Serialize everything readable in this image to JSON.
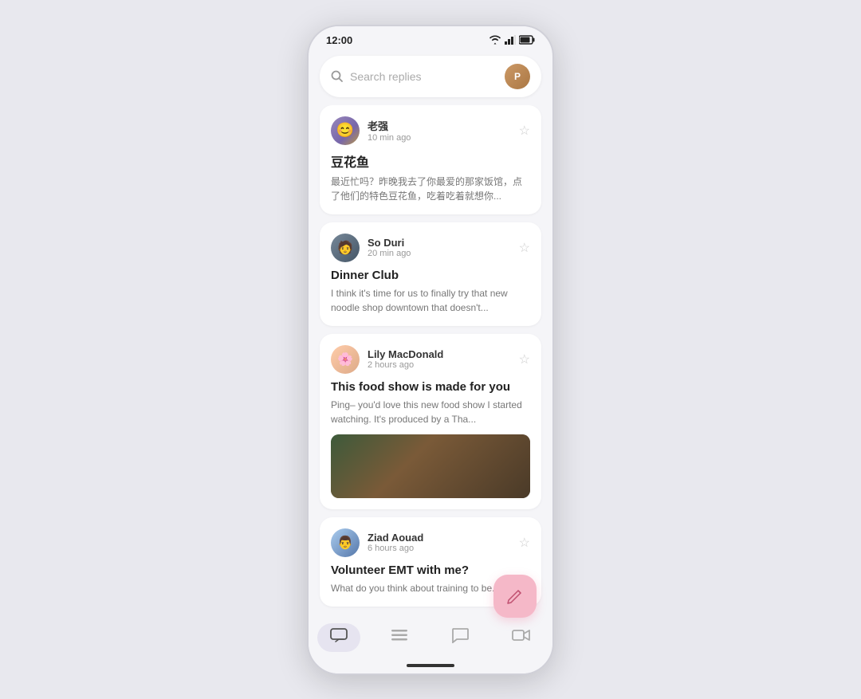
{
  "statusBar": {
    "time": "12:00"
  },
  "search": {
    "placeholder": "Search replies"
  },
  "messages": [
    {
      "id": 1,
      "sender": "老强",
      "time": "10 min ago",
      "title": "豆花鱼",
      "preview": "最近忙吗？昨晚我去了你最爱的那家饭馆，点了他们的特色豆花鱼，吃着吃着就想你...",
      "hasImage": false,
      "avatarClass": "avatar-face-1",
      "avatarEmoji": "👤"
    },
    {
      "id": 2,
      "sender": "So Duri",
      "time": "20 min ago",
      "title": "Dinner Club",
      "preview": "I think it's time for us to finally try that new noodle shop downtown that doesn't...",
      "hasImage": false,
      "avatarClass": "avatar-face-2",
      "avatarEmoji": "👤"
    },
    {
      "id": 3,
      "sender": "Lily MacDonald",
      "time": "2 hours ago",
      "title": "This food show is made for you",
      "preview": "Ping– you'd love this new food show I started watching. It's produced by a Tha...",
      "hasImage": true,
      "avatarClass": "avatar-face-3",
      "avatarEmoji": "🌸"
    },
    {
      "id": 4,
      "sender": "Ziad Aouad",
      "time": "6 hours ago",
      "title": "Volunteer EMT with me?",
      "preview": "What do you think about training to be...",
      "hasImage": false,
      "avatarClass": "avatar-face-4",
      "avatarEmoji": "👤"
    }
  ],
  "fab": {
    "label": "Compose"
  },
  "bottomNav": {
    "items": [
      {
        "icon": "🖥",
        "label": "Chat",
        "active": true
      },
      {
        "icon": "☰",
        "label": "Menu",
        "active": false
      },
      {
        "icon": "💬",
        "label": "Message",
        "active": false
      },
      {
        "icon": "🎥",
        "label": "Video",
        "active": false
      }
    ]
  }
}
